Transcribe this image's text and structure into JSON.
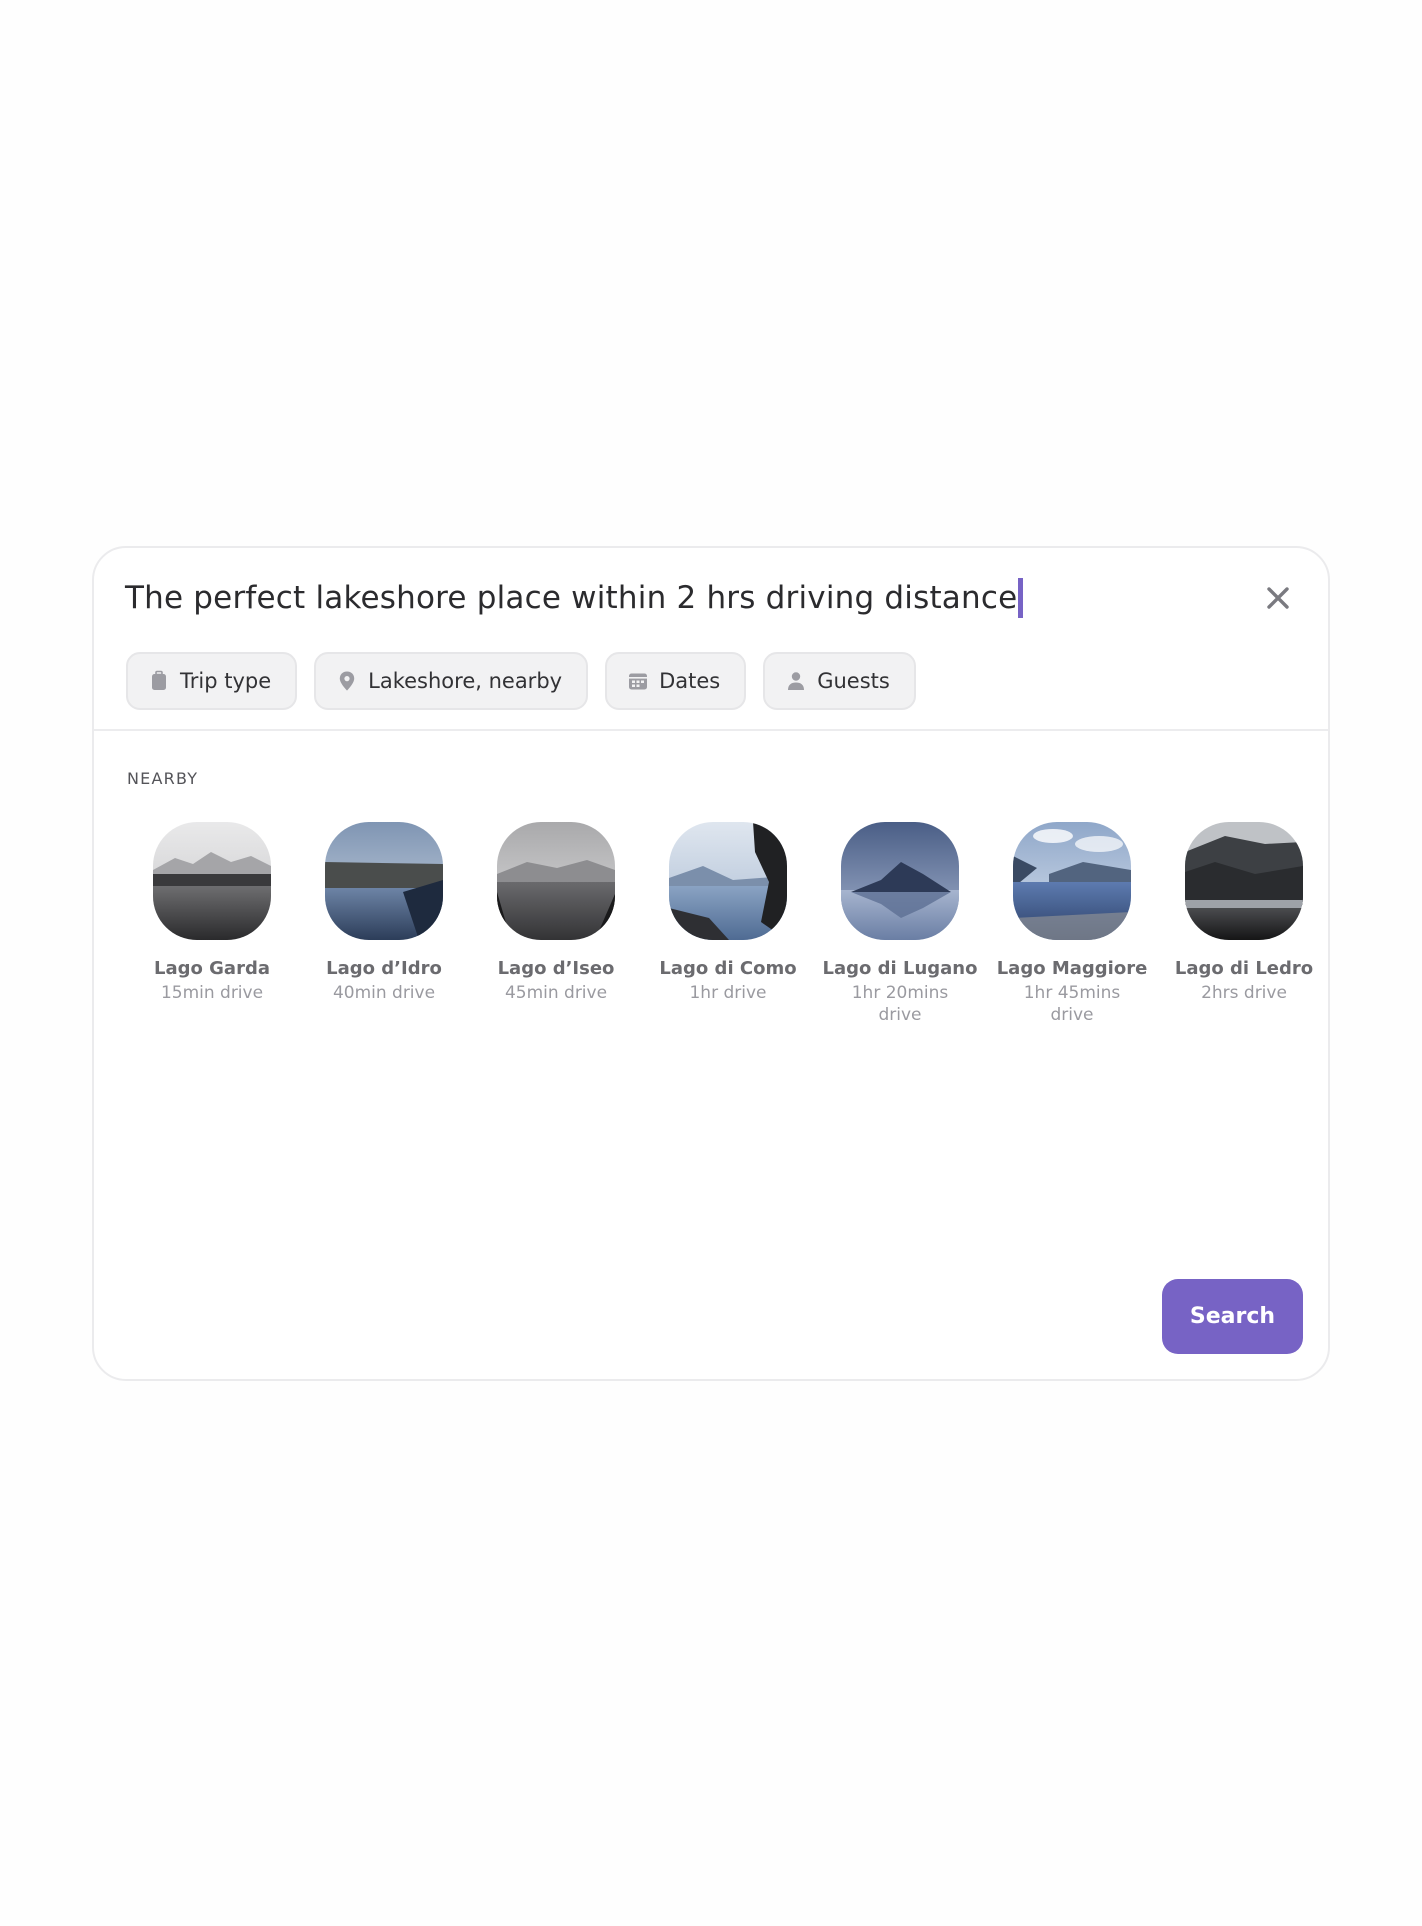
{
  "search": {
    "query": "The perfect lakeshore place within 2 hrs driving distance",
    "close_icon": "close-icon"
  },
  "filters": [
    {
      "label": "Trip type",
      "icon": "luggage-icon"
    },
    {
      "label": "Lakeshore, nearby",
      "icon": "location-pin-icon"
    },
    {
      "label": "Dates",
      "icon": "calendar-icon"
    },
    {
      "label": "Guests",
      "icon": "person-icon"
    }
  ],
  "nearby": {
    "heading": "NEARBY",
    "places": [
      {
        "name": "Lago Garda",
        "distance": "15min drive"
      },
      {
        "name": "Lago d’Idro",
        "distance": "40min drive"
      },
      {
        "name": "Lago d’Iseo",
        "distance": "45min drive"
      },
      {
        "name": "Lago di Como",
        "distance": "1hr drive"
      },
      {
        "name": "Lago di Lugano",
        "distance": "1hr 20mins drive"
      },
      {
        "name": "Lago Maggiore",
        "distance": "1hr 45mins drive"
      },
      {
        "name": "Lago di Ledro",
        "distance": "2hrs drive"
      }
    ]
  },
  "actions": {
    "search_label": "Search"
  },
  "colors": {
    "accent": "#7763c5",
    "chip_background": "#f2f2f3",
    "card_border": "#ebebed"
  }
}
